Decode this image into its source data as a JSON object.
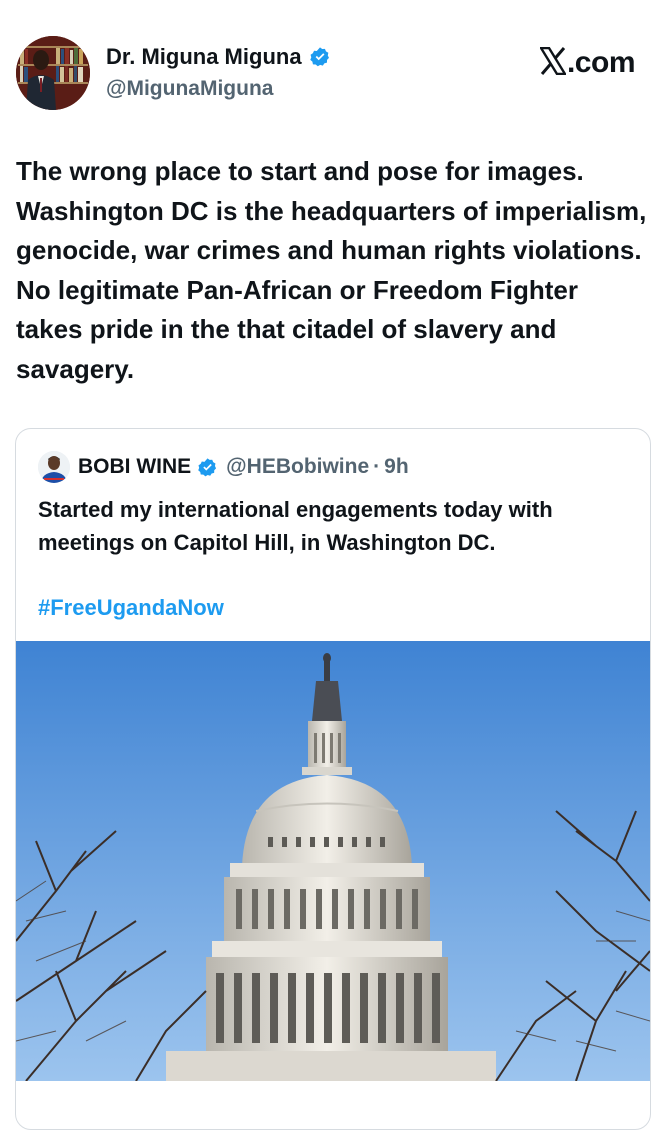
{
  "header": {
    "display_name": "Dr. Miguna Miguna",
    "handle": "@MigunaMiguna",
    "brand": ".com",
    "avatar_icon": "author-avatar",
    "verified_icon": "verified-badge-icon"
  },
  "tweet": {
    "text": "The wrong place to start and pose for images. Washington DC is the headquarters of imperialism, genocide, war crimes and human rights violations. No legitimate Pan-African or Freedom Fighter takes pride in the that citadel of slavery and savagery."
  },
  "quoted": {
    "display_name": "BOBI WINE",
    "handle": "@HEBobiwine",
    "separator": "·",
    "time": "9h",
    "text": "Started my international engagements today with meetings on Capitol Hill, in Washington DC.",
    "hashtag": "#FreeUgandaNow",
    "image_subject": "us-capitol-dome-photo"
  },
  "colors": {
    "verified": "#1d9bf0",
    "hashtag": "#1d9bf0",
    "secondary_text": "#536471",
    "sky": "#4f8fd9"
  }
}
